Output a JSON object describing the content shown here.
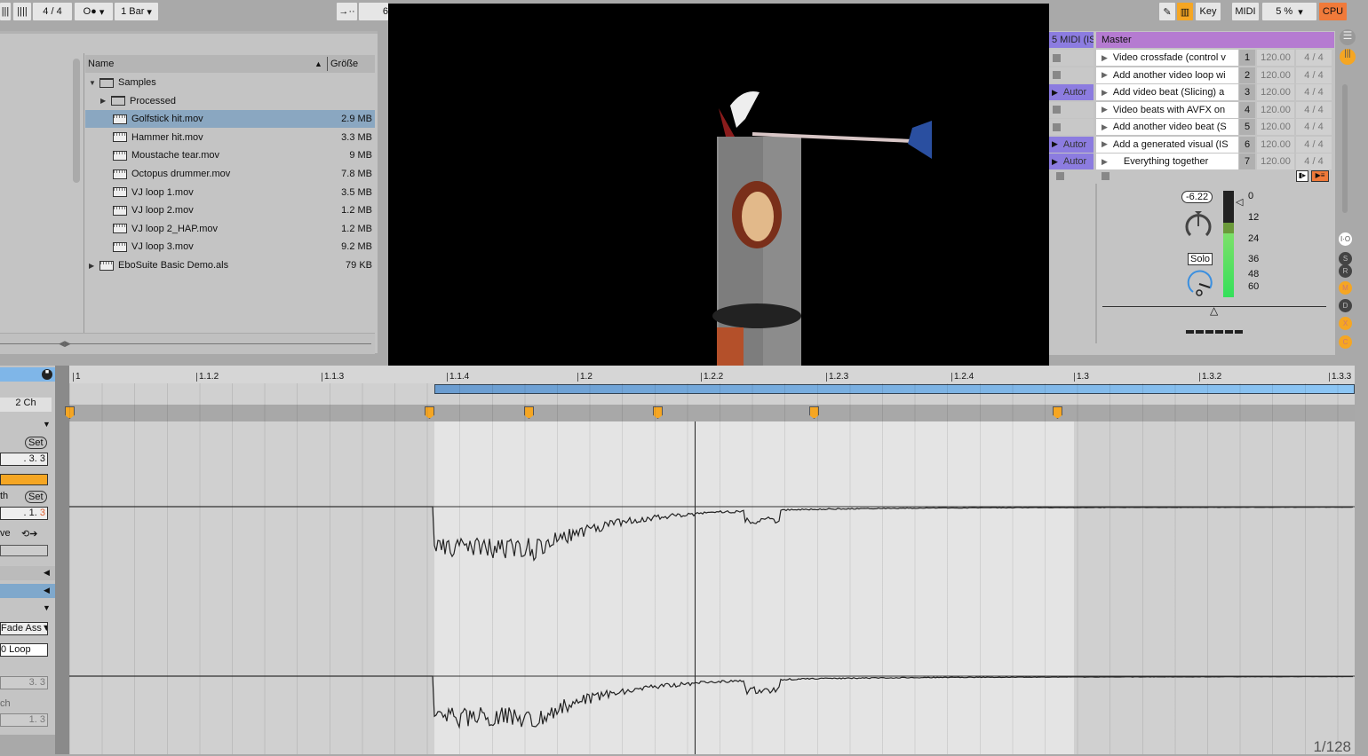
{
  "toolbar": {
    "time_sig": "4 / 4",
    "rec_mode": "O●",
    "quantize": "1 Bar",
    "follow": "→··",
    "bpm_partial": "6",
    "key_label": "Key",
    "midi_label": "MIDI",
    "cpu_value": "5 %",
    "cpu_label": "CPU"
  },
  "browser": {
    "col_name": "Name",
    "col_size": "Größe",
    "items": [
      {
        "name": "Samples",
        "size": "",
        "type": "folder",
        "expanded": true,
        "level": 0
      },
      {
        "name": "Processed",
        "size": "",
        "type": "folder",
        "expanded": false,
        "level": 1
      },
      {
        "name": "Golfstick hit.mov",
        "size": "2.9 MB",
        "type": "file",
        "level": 1,
        "selected": true
      },
      {
        "name": "Hammer hit.mov",
        "size": "3.3 MB",
        "type": "file",
        "level": 1
      },
      {
        "name": "Moustache tear.mov",
        "size": "9 MB",
        "type": "file",
        "level": 1
      },
      {
        "name": "Octopus drummer.mov",
        "size": "7.8 MB",
        "type": "file",
        "level": 1
      },
      {
        "name": "VJ loop 1.mov",
        "size": "3.5 MB",
        "type": "file",
        "level": 1
      },
      {
        "name": "VJ loop 2.mov",
        "size": "1.2 MB",
        "type": "file",
        "level": 1
      },
      {
        "name": "VJ loop 2_HAP.mov",
        "size": "1.2 MB",
        "type": "file",
        "level": 1
      },
      {
        "name": "VJ loop 3.mov",
        "size": "9.2 MB",
        "type": "file",
        "level": 1
      },
      {
        "name": "EboSuite Basic Demo.als",
        "size": "79 KB",
        "type": "set",
        "expanded": false,
        "level": 0
      }
    ]
  },
  "session": {
    "track_header": "5 MIDI (IS",
    "master_header": "Master",
    "scenes": [
      {
        "name": "Video crossfade (control v",
        "num": "1",
        "tempo": "120.00",
        "sig": "4 / 4",
        "clip": ""
      },
      {
        "name": "Add another video loop wi",
        "num": "2",
        "tempo": "120.00",
        "sig": "4 / 4",
        "clip": ""
      },
      {
        "name": "Add video beat (Slicing) a",
        "num": "3",
        "tempo": "120.00",
        "sig": "4 / 4",
        "clip": "Autor"
      },
      {
        "name": "Video beats with AVFX on",
        "num": "4",
        "tempo": "120.00",
        "sig": "4 / 4",
        "clip": ""
      },
      {
        "name": "Add another video beat (S",
        "num": "5",
        "tempo": "120.00",
        "sig": "4 / 4",
        "clip": ""
      },
      {
        "name": "Add a generated visual (IS",
        "num": "6",
        "tempo": "120.00",
        "sig": "4 / 4",
        "clip": "Autor"
      },
      {
        "name": "Everything together",
        "num": "7",
        "tempo": "120.00",
        "sig": "4 / 4",
        "clip": "Autor"
      }
    ],
    "volume": "-6.22",
    "solo": "Solo",
    "meter_ticks": [
      "0",
      "12",
      "24",
      "36",
      "48",
      "60"
    ],
    "side_buttons": [
      "I·O",
      "S",
      "R",
      "M",
      "D",
      "X",
      "C"
    ]
  },
  "clip_view": {
    "channels": "2 Ch",
    "set1": "Set",
    "pos1": ".   3.   3",
    "set2": "Set",
    "label_th": "th",
    "pos2": ".   1.",
    "pos2_last": "3",
    "label_ve": "ve",
    "warp_mode": "Fade Ass▼",
    "loop_label": "0 Loop",
    "pos3": "3.   3",
    "label_ch": "ch",
    "pos4": "1.   3"
  },
  "arrangement": {
    "ruler": [
      "1",
      "1.1.2",
      "1.1.3",
      "1.1.4",
      "1.2",
      "1.2.2",
      "1.2.3",
      "1.2.4",
      "1.3",
      "1.3.2",
      "1.3.3"
    ],
    "grid": "1/128"
  },
  "colors": {
    "accent": "#f5a623",
    "loop": "#7fb6e8",
    "master": "#b57bd1",
    "track": "#8c7ce0",
    "cpu": "#f07a3a"
  }
}
